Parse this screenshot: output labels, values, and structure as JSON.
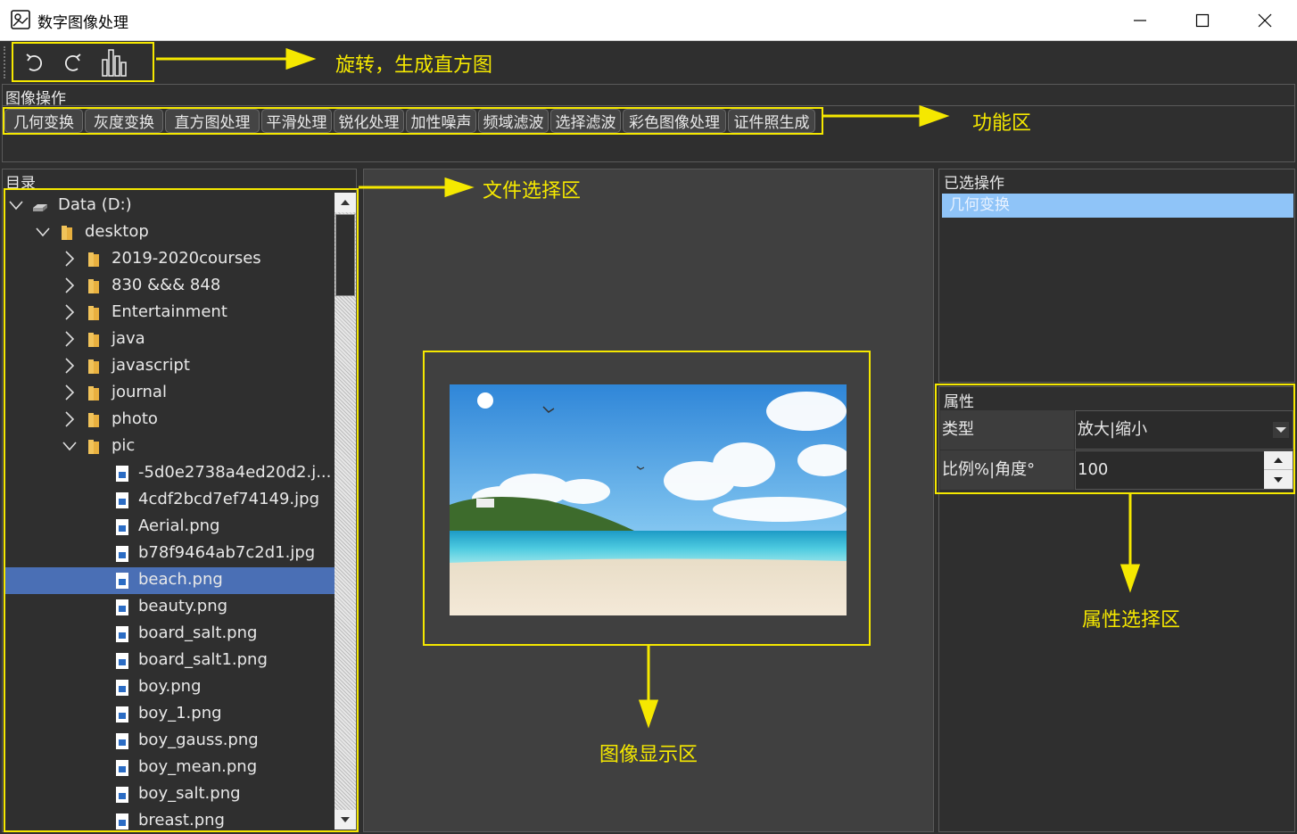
{
  "window": {
    "title": "数字图像处理",
    "minimize_icon": "minimize-icon",
    "maximize_icon": "maximize-icon",
    "close_icon": "close-icon"
  },
  "toolbar": {
    "buttons": [
      {
        "name": "rotate-left",
        "icon": "rotate-left-icon"
      },
      {
        "name": "rotate-right",
        "icon": "rotate-right-icon"
      },
      {
        "name": "histogram",
        "icon": "histogram-icon"
      }
    ]
  },
  "ops_group": {
    "title": "图像操作",
    "tabs": [
      "几何变换",
      "灰度变换",
      "直方图处理",
      "平滑处理",
      "锐化处理",
      "加性噪声",
      "频域滤波",
      "选择滤波",
      "彩色图像处理",
      "证件照生成"
    ]
  },
  "directory": {
    "title": "目录",
    "items": [
      {
        "label": "Data (D:)",
        "level": 0,
        "type": "drive",
        "expanded": true
      },
      {
        "label": "desktop",
        "level": 1,
        "type": "folder",
        "expanded": true
      },
      {
        "label": "2019-2020courses",
        "level": 2,
        "type": "folder",
        "expanded": false
      },
      {
        "label": "830 &&& 848",
        "level": 2,
        "type": "folder",
        "expanded": false
      },
      {
        "label": "Entertainment",
        "level": 2,
        "type": "folder",
        "expanded": false
      },
      {
        "label": "java",
        "level": 2,
        "type": "folder",
        "expanded": false
      },
      {
        "label": "javascript",
        "level": 2,
        "type": "folder",
        "expanded": false
      },
      {
        "label": "journal",
        "level": 2,
        "type": "folder",
        "expanded": false
      },
      {
        "label": "photo",
        "level": 2,
        "type": "folder",
        "expanded": false
      },
      {
        "label": "pic",
        "level": 2,
        "type": "folder",
        "expanded": true
      },
      {
        "label": "-5d0e2738a4ed20d2.j...",
        "level": 3,
        "type": "file"
      },
      {
        "label": "4cdf2bcd7ef74149.jpg",
        "level": 3,
        "type": "file"
      },
      {
        "label": "Aerial.png",
        "level": 3,
        "type": "file"
      },
      {
        "label": "b78f9464ab7c2d1.jpg",
        "level": 3,
        "type": "file"
      },
      {
        "label": "beach.png",
        "level": 3,
        "type": "file",
        "selected": true
      },
      {
        "label": "beauty.png",
        "level": 3,
        "type": "file"
      },
      {
        "label": "board_salt.png",
        "level": 3,
        "type": "file"
      },
      {
        "label": "board_salt1.png",
        "level": 3,
        "type": "file"
      },
      {
        "label": "boy.png",
        "level": 3,
        "type": "file"
      },
      {
        "label": "boy_1.png",
        "level": 3,
        "type": "file"
      },
      {
        "label": "boy_gauss.png",
        "level": 3,
        "type": "file"
      },
      {
        "label": "boy_mean.png",
        "level": 3,
        "type": "file"
      },
      {
        "label": "boy_salt.png",
        "level": 3,
        "type": "file"
      },
      {
        "label": "breast.png",
        "level": 3,
        "type": "file"
      }
    ]
  },
  "selected_ops": {
    "title": "已选操作",
    "items": [
      "几何变换"
    ]
  },
  "properties": {
    "title": "属性",
    "rows": [
      {
        "label": "类型",
        "value": "放大|缩小",
        "control": "dropdown"
      },
      {
        "label": "比例%|角度°",
        "value": "100",
        "control": "spinbox"
      }
    ]
  },
  "annotations": {
    "toolbar": "旋转，生成直方图",
    "functions": "功能区",
    "files": "文件选择区",
    "image": "图像显示区",
    "properties": "属性选择区"
  },
  "colors": {
    "background": "#2f2f2f",
    "annotation": "#f5e800",
    "selection": "#4a6fb5",
    "selected_op": "#8fc4f8"
  }
}
